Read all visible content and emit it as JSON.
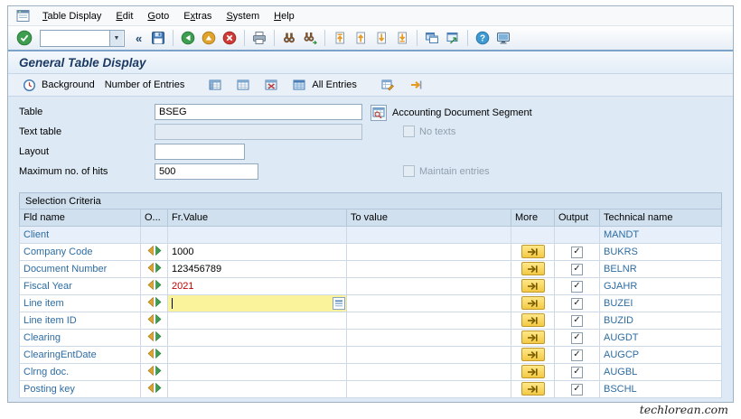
{
  "title": "General Table Display",
  "menu": {
    "items": [
      {
        "label": "Table Display",
        "ak": 0
      },
      {
        "label": "Edit",
        "ak": 0
      },
      {
        "label": "Goto",
        "ak": 0
      },
      {
        "label": "Extras",
        "ak": 1
      },
      {
        "label": "System",
        "ak": 0
      },
      {
        "label": "Help",
        "ak": 0
      }
    ]
  },
  "toolbar": {
    "command_value": "",
    "collapse_glyph": "«",
    "groups": [
      [
        "save-icon"
      ],
      [
        "back-icon",
        "exit-icon",
        "cancel-icon"
      ],
      [
        "print-icon"
      ],
      [
        "find-icon",
        "find-next-icon"
      ],
      [
        "first-page-icon",
        "previous-page-icon",
        "next-page-icon",
        "last-page-icon"
      ],
      [
        "new-session-icon",
        "shortcut-icon"
      ],
      [
        "help-icon",
        "customize-layout-icon"
      ]
    ]
  },
  "app_toolbar": {
    "items": [
      {
        "type": "button",
        "name": "background-button",
        "icon": "clock-icon",
        "label": "Background"
      },
      {
        "type": "button",
        "name": "number-of-entries-button",
        "label": "Number of Entries"
      },
      {
        "type": "gap"
      },
      {
        "type": "icon-button",
        "name": "select-all-button",
        "icon": "select-all-icon"
      },
      {
        "type": "icon-button",
        "name": "deselect-all-button",
        "icon": "deselect-all-icon"
      },
      {
        "type": "icon-button",
        "name": "delete-selection-button",
        "icon": "delete-selection-icon"
      },
      {
        "type": "button",
        "name": "all-entries-button",
        "icon": "all-entries-icon",
        "label": "All Entries"
      },
      {
        "type": "gap"
      },
      {
        "type": "icon-button",
        "name": "maintain-entries-button",
        "icon": "maintain-grid-icon"
      },
      {
        "type": "icon-button",
        "name": "forward-button",
        "icon": "forward-icon"
      }
    ]
  },
  "form": {
    "rows": [
      {
        "label": "Table",
        "value": "BSEG",
        "size": "large",
        "extra_icon": "table-documentation-icon",
        "extra_text": "Accounting Document Segment"
      },
      {
        "label": "Text table",
        "value": "",
        "size": "large",
        "disabled": true,
        "checkbox": {
          "label": "No texts",
          "checked": false,
          "disabled": true
        }
      },
      {
        "label": "Layout",
        "value": "",
        "size": "small"
      },
      {
        "label": "Maximum no. of hits",
        "value": "500",
        "size": "medium",
        "checkbox": {
          "label": "Maintain entries",
          "checked": false,
          "disabled": true
        }
      }
    ]
  },
  "selection": {
    "section_title": "Selection Criteria",
    "columns": [
      "Fld name",
      "O...",
      "Fr.Value",
      "To value",
      "More",
      "Output",
      "Technical name"
    ],
    "rows": [
      {
        "fld": "Client",
        "fr": "",
        "tech": "MANDT",
        "op": false,
        "more": false,
        "output": false,
        "readonly": true
      },
      {
        "fld": "Company Code",
        "fr": "1000",
        "tech": "BUKRS",
        "op": true,
        "more": true,
        "output": true
      },
      {
        "fld": "Document Number",
        "fr": "123456789",
        "tech": "BELNR",
        "op": true,
        "more": true,
        "output": true
      },
      {
        "fld": "Fiscal Year",
        "fr": "2021",
        "fr_red": true,
        "tech": "GJAHR",
        "op": true,
        "more": true,
        "output": true
      },
      {
        "fld": "Line item",
        "fr": "",
        "tech": "BUZEI",
        "op": true,
        "more": true,
        "output": true,
        "focused": true
      },
      {
        "fld": "Line item ID",
        "fr": "",
        "tech": "BUZID",
        "op": true,
        "more": true,
        "output": true
      },
      {
        "fld": "Clearing",
        "fr": "",
        "tech": "AUGDT",
        "op": true,
        "more": true,
        "output": true
      },
      {
        "fld": "ClearingEntDate",
        "fr": "",
        "tech": "AUGCP",
        "op": true,
        "more": true,
        "output": true
      },
      {
        "fld": "Clrng doc.",
        "fr": "",
        "tech": "AUGBL",
        "op": true,
        "more": true,
        "output": true
      },
      {
        "fld": "Posting key",
        "fr": "",
        "tech": "BSCHL",
        "op": true,
        "more": true,
        "output": true
      }
    ]
  },
  "colors": {
    "accent_blue": "#2d6ca2",
    "focused_cell": "#fbf39b",
    "error_red": "#c00000",
    "more_button_yellow": "#f3c944"
  },
  "footer": {
    "watermark": "techlorean.com"
  }
}
